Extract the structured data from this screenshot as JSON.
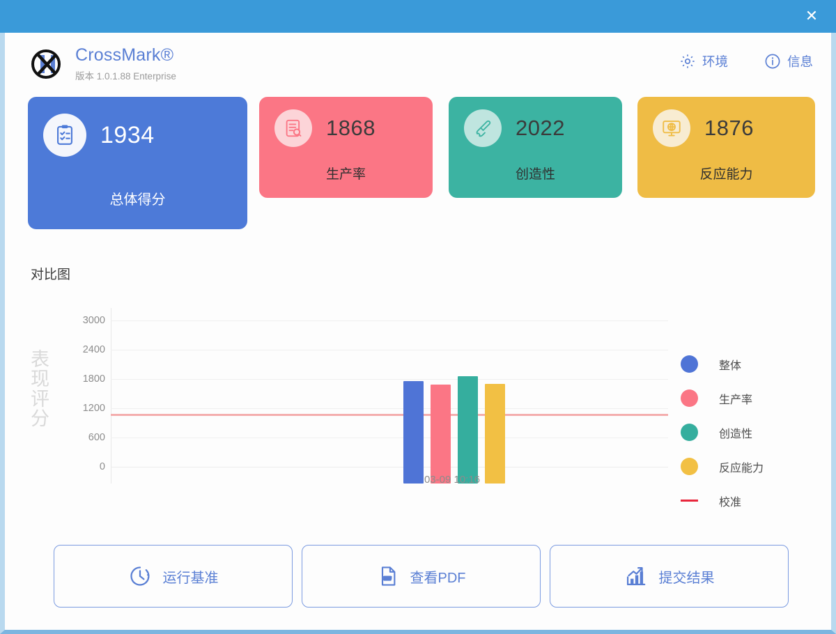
{
  "window": {
    "titlebar_color": "#3a9ad9",
    "close_label": "✕"
  },
  "header": {
    "brand_name": "CrossMark®",
    "version": "版本 1.0.1.88 Enterprise",
    "brand_color": "#5a7fd4",
    "actions": [
      {
        "label": "环境",
        "icon": "gear-icon"
      },
      {
        "label": "信息",
        "icon": "info-icon"
      }
    ]
  },
  "cards": [
    {
      "score": "1934",
      "label": "总体得分",
      "color": "#4d7ad8",
      "icon": "clipboard-check-icon"
    },
    {
      "score": "1868",
      "label": "生产率",
      "color": "#fb7685",
      "icon": "document-search-icon"
    },
    {
      "score": "2022",
      "label": "创造性",
      "color": "#3cb3a2",
      "icon": "paintbrush-icon"
    },
    {
      "score": "1876",
      "label": "反应能力",
      "color": "#efbc45",
      "icon": "monitor-globe-icon"
    }
  ],
  "chart_section": {
    "title": "对比图"
  },
  "chart_data": {
    "type": "bar",
    "title": "对比图",
    "xlabel": "",
    "ylabel": "表现评分",
    "categories": [
      "03-09 10:16"
    ],
    "yticks": [
      "3000",
      "2400",
      "1800",
      "1200",
      "600",
      "0"
    ],
    "ylim": [
      0,
      3000
    ],
    "grid": true,
    "legend_position": "right",
    "series": [
      {
        "name": "整体",
        "color": "#4f74d6",
        "values": [
          1934
        ]
      },
      {
        "name": "生产率",
        "color": "#fb7685",
        "values": [
          1868
        ]
      },
      {
        "name": "创造性",
        "color": "#35ae9e",
        "values": [
          2022
        ]
      },
      {
        "name": "反应能力",
        "color": "#f2c044",
        "values": [
          1876
        ]
      }
    ],
    "reference_line": {
      "name": "校准",
      "color": "#e8273c",
      "line_color": "#f4aeae",
      "value": 1000
    }
  },
  "footer": {
    "buttons": [
      {
        "label": "运行基准",
        "icon": "timer-icon"
      },
      {
        "label": "查看PDF",
        "icon": "pdf-file-icon"
      },
      {
        "label": "提交结果",
        "icon": "chart-upload-icon"
      }
    ]
  }
}
